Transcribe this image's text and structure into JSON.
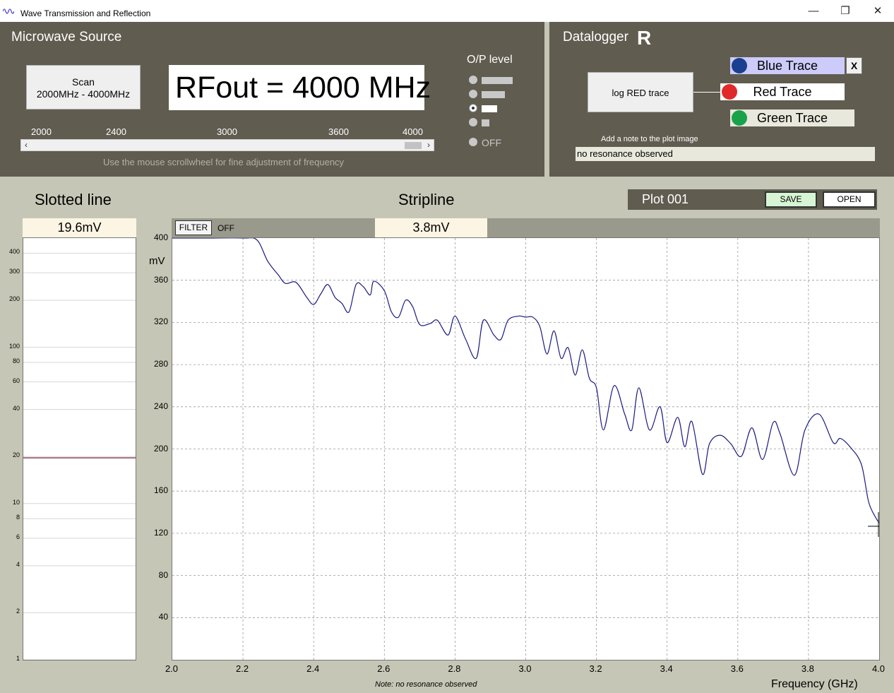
{
  "window": {
    "title": "Wave Transmission and Reflection",
    "controls": {
      "minimize": "—",
      "restore": "❐",
      "close": "✕"
    }
  },
  "microwave_source": {
    "title": "Microwave Source",
    "scan_button": {
      "line1": "Scan",
      "line2": "2000MHz - 4000MHz"
    },
    "rfout_display": "RFout = 4000 MHz",
    "freq_ticks": [
      "2000",
      "2400",
      "3000",
      "3600",
      "4000"
    ],
    "scroll_position_fraction": 1.0,
    "hint": "Use the mouse scrollwheel for fine adjustment of frequency",
    "op_level": {
      "title": "O/P level",
      "options": [
        "level-4",
        "level-3",
        "level-2",
        "level-1",
        "OFF"
      ],
      "selected_index": 2,
      "off_label": "OFF"
    }
  },
  "datalogger": {
    "title": "Datalogger",
    "letter": "R",
    "log_button": "log RED trace",
    "traces": [
      {
        "label": "Blue Trace",
        "color": "#1a3f8f",
        "bg": "#cccbfa"
      },
      {
        "label": "Red Trace",
        "color": "#e02a2a",
        "bg": "#ffffff"
      },
      {
        "label": "Green Trace",
        "color": "#1aa24a",
        "bg": "#e8e8dc"
      }
    ],
    "close_label": "X",
    "note_label": "Add a note to the plot image",
    "note_value": "no resonance observed"
  },
  "slotted_line": {
    "title": "Slotted line",
    "reading": "19.6mV",
    "y_ticks": [
      "400",
      "300",
      "200",
      "100",
      "80",
      "60",
      "40",
      "20",
      "10",
      "8",
      "6",
      "4",
      "2",
      "1"
    ]
  },
  "stripline": {
    "title": "Stripline",
    "filter_button": "FILTER",
    "filter_state": "OFF",
    "reading": "3.8mV",
    "plot_name": "Plot 001",
    "save_label": "SAVE",
    "open_label": "OPEN",
    "y_unit": "mV",
    "x_label": "Frequency (GHz)",
    "note": "Note: no resonance observed"
  },
  "chart_data": [
    {
      "type": "line",
      "scale": "log",
      "ylim": [
        1,
        500
      ],
      "xlim": [
        2.0,
        4.0
      ],
      "y_ticks": [
        1,
        2,
        4,
        6,
        8,
        10,
        20,
        40,
        60,
        80,
        100,
        200,
        300,
        400
      ],
      "series": [
        {
          "color": "#7a1e3a",
          "x": [
            2.0,
            4.0
          ],
          "y": [
            19.6,
            19.6
          ]
        }
      ]
    },
    {
      "type": "line",
      "xlim": [
        2.0,
        4.0
      ],
      "ylim": [
        0,
        400
      ],
      "x_ticks": [
        "2.0",
        "2.2",
        "2.4",
        "2.6",
        "2.8",
        "3.0",
        "3.2",
        "3.4",
        "3.6",
        "3.8",
        "4.0"
      ],
      "y_ticks": [
        "40",
        "80",
        "120",
        "160",
        "200",
        "240",
        "280",
        "320",
        "360",
        "400"
      ],
      "grid": true,
      "series": [
        {
          "color": "#1a1a80",
          "x": [
            2.0,
            2.1,
            2.2,
            2.24,
            2.27,
            2.3,
            2.32,
            2.35,
            2.38,
            2.4,
            2.42,
            2.44,
            2.46,
            2.48,
            2.5,
            2.52,
            2.54,
            2.56,
            2.57,
            2.6,
            2.62,
            2.64,
            2.66,
            2.68,
            2.7,
            2.73,
            2.75,
            2.78,
            2.8,
            2.83,
            2.86,
            2.88,
            2.91,
            2.93,
            2.95,
            2.98,
            3.0,
            3.02,
            3.04,
            3.06,
            3.08,
            3.1,
            3.12,
            3.14,
            3.16,
            3.18,
            3.2,
            3.22,
            3.25,
            3.28,
            3.3,
            3.32,
            3.35,
            3.38,
            3.4,
            3.43,
            3.45,
            3.47,
            3.5,
            3.52,
            3.55,
            3.58,
            3.61,
            3.64,
            3.67,
            3.7,
            3.72,
            3.76,
            3.79,
            3.83,
            3.87,
            3.89,
            3.92,
            3.95,
            3.97,
            3.99,
            4.0
          ],
          "y": [
            400,
            400,
            400,
            398,
            378,
            365,
            357,
            358,
            344,
            337,
            347,
            356,
            344,
            338,
            330,
            356,
            354,
            346,
            359,
            350,
            330,
            325,
            341,
            335,
            318,
            319,
            322,
            308,
            326,
            304,
            286,
            322,
            308,
            304,
            322,
            326,
            325,
            325,
            316,
            290,
            312,
            286,
            296,
            270,
            294,
            267,
            258,
            218,
            260,
            233,
            218,
            258,
            218,
            240,
            206,
            230,
            202,
            226,
            176,
            205,
            213,
            205,
            193,
            220,
            190,
            225,
            214,
            175,
            218,
            233,
            206,
            210,
            201,
            185,
            150,
            135,
            130
          ]
        }
      ]
    }
  ]
}
